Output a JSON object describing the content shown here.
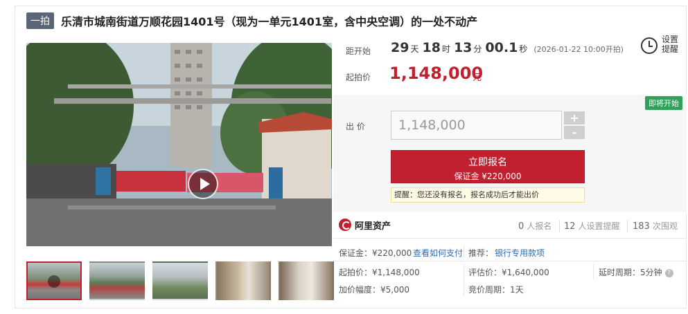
{
  "header": {
    "tag": "一拍",
    "title": "乐清市城南街道万顺花园1401号（现为一单元1401室，含中央空调）的一处不动产"
  },
  "countdown": {
    "label": "距开始",
    "days": "29",
    "days_unit": "天",
    "hours": "18",
    "hours_unit": "时",
    "minutes": "13",
    "minutes_unit": "分",
    "seconds": "00.1",
    "seconds_unit": "秒",
    "start_note": "(2026-01-22 10:00开拍)"
  },
  "reminder": {
    "label": "设置提醒",
    "icon": "clock-icon"
  },
  "starting_price": {
    "label": "起拍价",
    "value": "1,148,000",
    "unit": "元"
  },
  "bid": {
    "badge": "即将开始",
    "label": "出 价",
    "input_value": "1,148,000",
    "plus": "+",
    "minus": "-",
    "register_button": "立即报名",
    "deposit_line": "保证金 ¥220,000",
    "tip": "提醒：您还没有报名，报名成功后才能出价"
  },
  "stats": {
    "brand": "阿里资产",
    "registrations": {
      "count": "0",
      "label": "人报名"
    },
    "reminders": {
      "count": "12",
      "label": "人设置提醒"
    },
    "views": {
      "count": "183",
      "label": "次围观"
    }
  },
  "info": {
    "deposit": "保证金：¥220,000",
    "how_to_pay": "查看如何支付",
    "recommend_label": "推荐：",
    "recommend_link": "银行专用款项",
    "start_price": "起拍价：¥1,148,000",
    "appraisal": "评估价：¥1,640,000",
    "delay_period": "延时周期：5分钟",
    "increment": "加价幅度：¥5,000",
    "bidding_period": "竞价周期：1天"
  },
  "gallery": {
    "thumbnails": [
      "entrance-gate",
      "street-view",
      "building-exterior",
      "interior-hallway",
      "interior-room"
    ]
  },
  "colors": {
    "accent": "#c0202f",
    "badge_green": "#2fa15a",
    "link_blue": "#2b6cb5"
  }
}
